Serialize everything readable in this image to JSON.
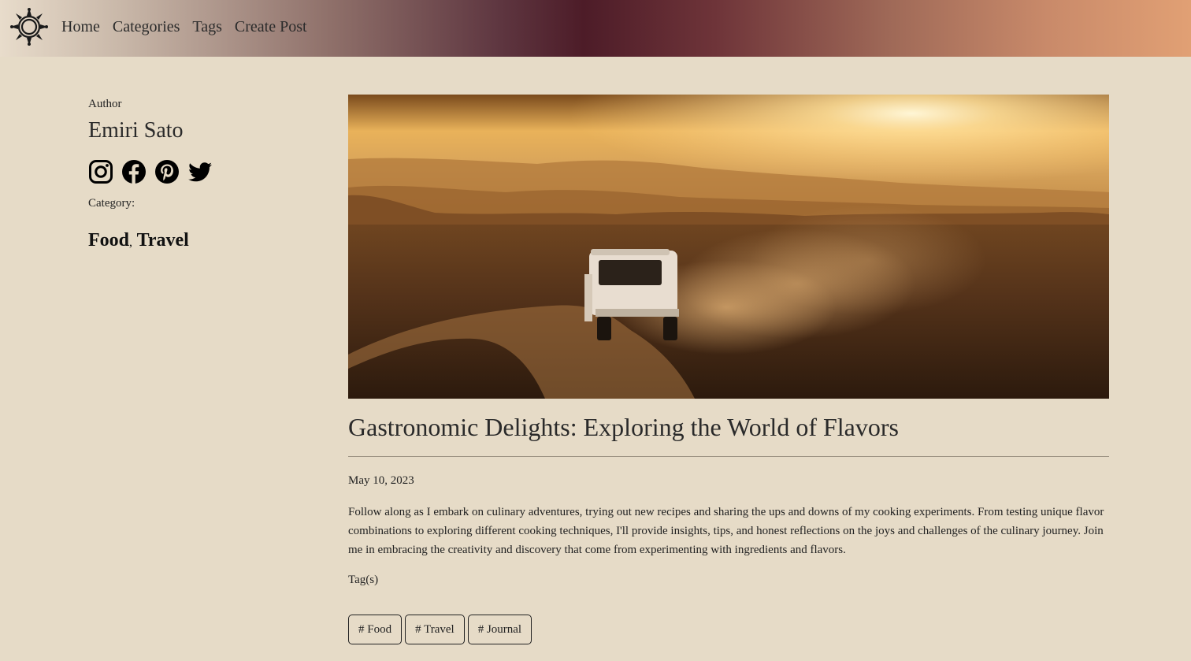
{
  "nav": {
    "logo_icon": "sun-ornament-icon",
    "links": [
      "Home",
      "Categories",
      "Tags",
      "Create Post"
    ]
  },
  "sidebar": {
    "author_label": "Author",
    "author_name": "Emiri Sato",
    "socials": [
      "instagram-icon",
      "facebook-icon",
      "pinterest-icon",
      "twitter-icon"
    ],
    "category_label": "Category:",
    "categories": [
      "Food",
      "Travel"
    ],
    "category_separator": ","
  },
  "post": {
    "title": "Gastronomic Delights: Exploring the World of Flavors",
    "date": "May 10, 2023",
    "body": "Follow along as I embark on culinary adventures, trying out new recipes and sharing the ups and downs of my cooking experiments. From testing unique flavor combinations to exploring different cooking techniques, I'll provide insights, tips, and honest reflections on the joys and challenges of the culinary journey. Join me in embracing the creativity and discovery that come from experimenting with ingredients and flavors.",
    "tags_label": "Tag(s)",
    "tags": [
      "# Food",
      "# Travel",
      "# Journal"
    ]
  },
  "colors": {
    "page_background": "#e6dbc7",
    "nav_gradient_mid": "#4d1c28",
    "nav_gradient_end": "#e1a074"
  }
}
